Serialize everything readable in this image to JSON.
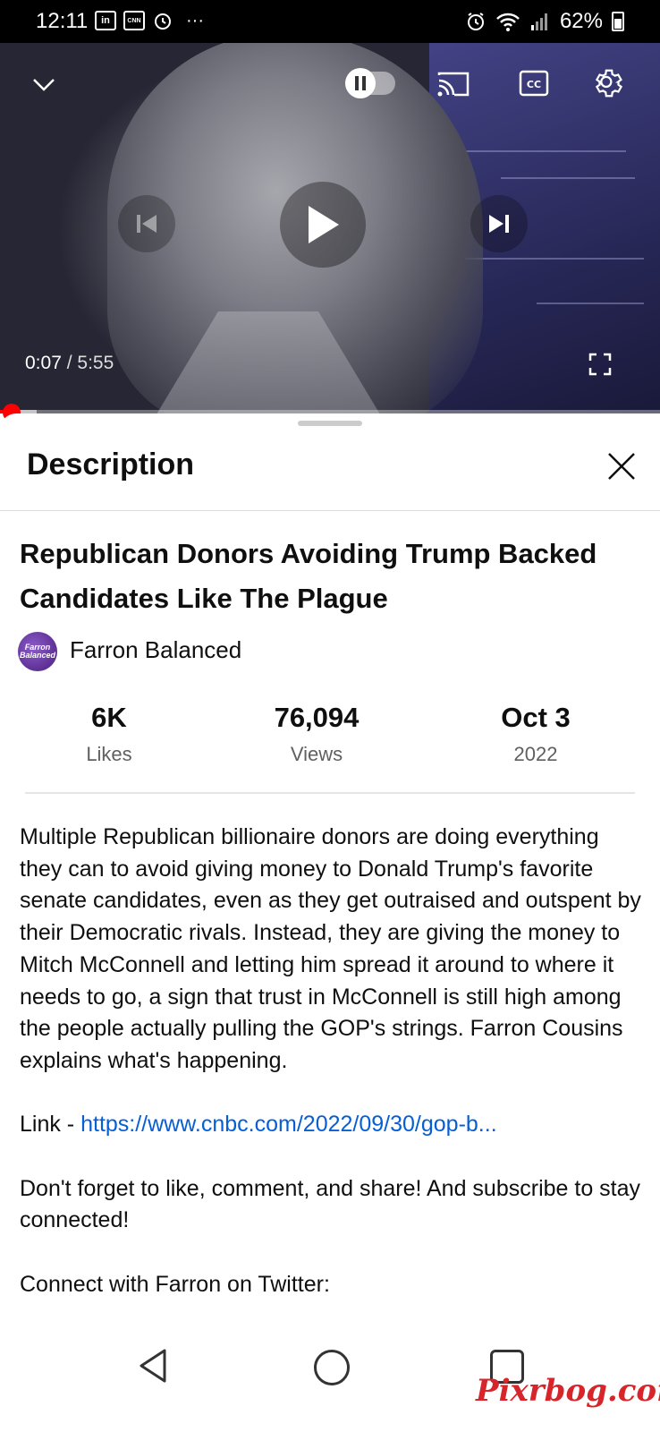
{
  "status_bar": {
    "time": "12:11",
    "left_icons": [
      "linkedin-icon",
      "cnn-icon",
      "alarm-notification-icon",
      "more-dots-icon"
    ],
    "linkedin_text": "in",
    "cnn_text": "CNN",
    "dots": "···",
    "right_icons": [
      "alarm-icon",
      "wifi-icon",
      "signal-icon",
      "battery-icon"
    ],
    "battery": "62%"
  },
  "player": {
    "current_time": "0:07",
    "separator": " / ",
    "total_time": "5:55",
    "progress_fraction": 0.02,
    "buffer_fraction": 0.055,
    "autoplay_paused": true
  },
  "description_sheet": {
    "header": "Description",
    "video_title": "Republican Donors Avoiding Trump Backed Candidates Like The Plague",
    "channel_name": "Farron Balanced",
    "avatar_text": "Farron Balanced",
    "stats": [
      {
        "value": "6K",
        "label": "Likes"
      },
      {
        "value": "76,094",
        "label": "Views"
      },
      {
        "value": "Oct 3",
        "label": "2022"
      }
    ],
    "description_paragraph": "Multiple Republican billionaire donors are doing everything they can to avoid giving money to Donald Trump's favorite senate candidates, even as they get outraised and outspent by their Democratic rivals. Instead, they are giving the money to Mitch McConnell and letting him spread it around to where it needs to go, a sign that trust in McConnell is still high among the people actually pulling the GOP's strings. Farron Cousins explains what's happening.",
    "link_prefix": "Link - ",
    "link_url": "https://www.cnbc.com/2022/09/30/gop-b...",
    "cta": "Don't forget to like, comment, and share! And subscribe to stay connected!",
    "twitter_line": "Connect with Farron on Twitter:"
  },
  "watermark": "Pixrbog.com",
  "colors": {
    "accent_red": "#ff0000",
    "link_blue": "#065fd4",
    "text_primary": "#0f0f0f",
    "text_secondary": "#606060"
  }
}
